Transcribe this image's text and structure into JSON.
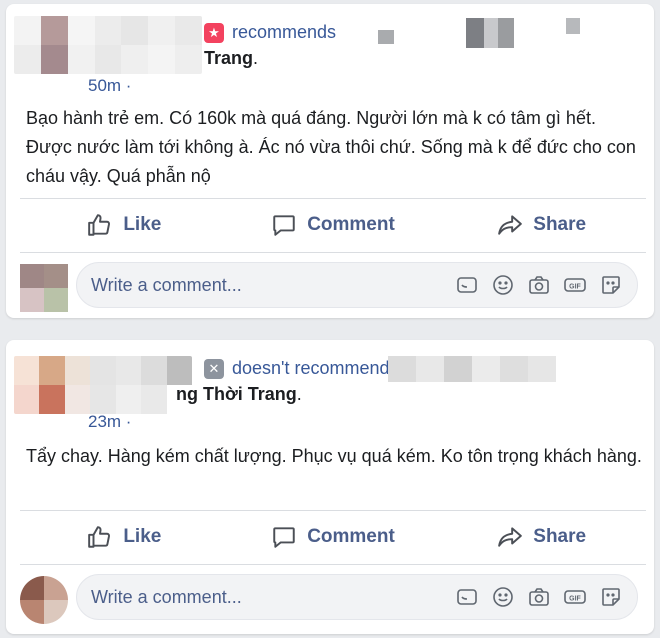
{
  "reviews": [
    {
      "recommendation": "recommends",
      "page_name": "Trang",
      "name_suffix": ".",
      "time": "50m ·",
      "text": "Bạo hành trẻ em. Có 160k mà quá đáng. Người lớn mà k có tâm gì hết. Được nước làm tới không à. Ác nó vừa thôi chứ. Sống mà k để đức cho con cháu vậy. Quá phẫn nộ",
      "icon": "recommend-star-icon",
      "icon_color": "#f3425f"
    },
    {
      "recommendation": "doesn't recommend",
      "page_name": "ng Thời Trang",
      "name_suffix": ".",
      "time": "23m ·",
      "text": "Tẩy chay. Hàng kém chất lượng. Phục vụ quá kém. Ko tôn trọng khách hàng.",
      "icon": "not-recommend-icon",
      "icon_color": "#8d949e"
    }
  ],
  "actions": {
    "like": "Like",
    "comment": "Comment",
    "share": "Share"
  },
  "comment_box": {
    "placeholder": "Write a comment...",
    "icons": [
      "sticker-icon",
      "emoji-icon",
      "camera-icon",
      "gif-icon",
      "sticker-face-icon"
    ]
  },
  "colors": {
    "link": "#385898",
    "action_text": "#4b5e8a",
    "background": "#e9ebee"
  }
}
